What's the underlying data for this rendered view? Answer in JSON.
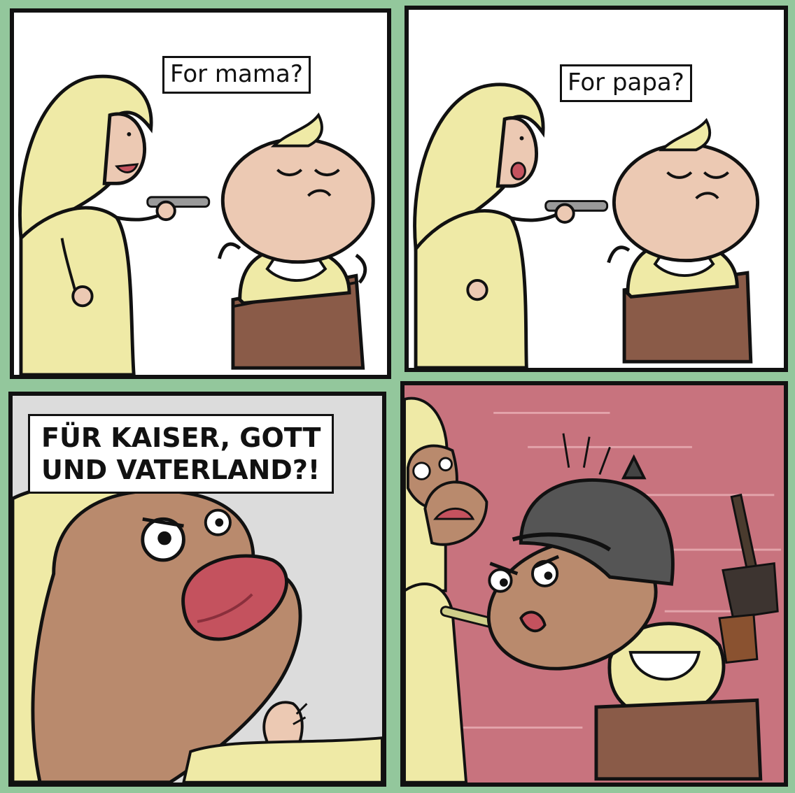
{
  "comic": {
    "panels": [
      {
        "caption": "For mama?"
      },
      {
        "caption": "For papa?"
      },
      {
        "caption": "FÜR KAISER, GOTT\nUND VATERLAND?!"
      },
      {
        "caption": ""
      }
    ]
  },
  "colors": {
    "page_background": "#93c79c",
    "panel_border": "#111111",
    "hair": "#efeaa6",
    "skin": "#ecc9b3",
    "dark_skin": "#b98a6d",
    "chair": "#8a5b48",
    "panel4_background": "#c8737e",
    "panel3_background": "#dcdcdc",
    "helmet": "#555555"
  }
}
